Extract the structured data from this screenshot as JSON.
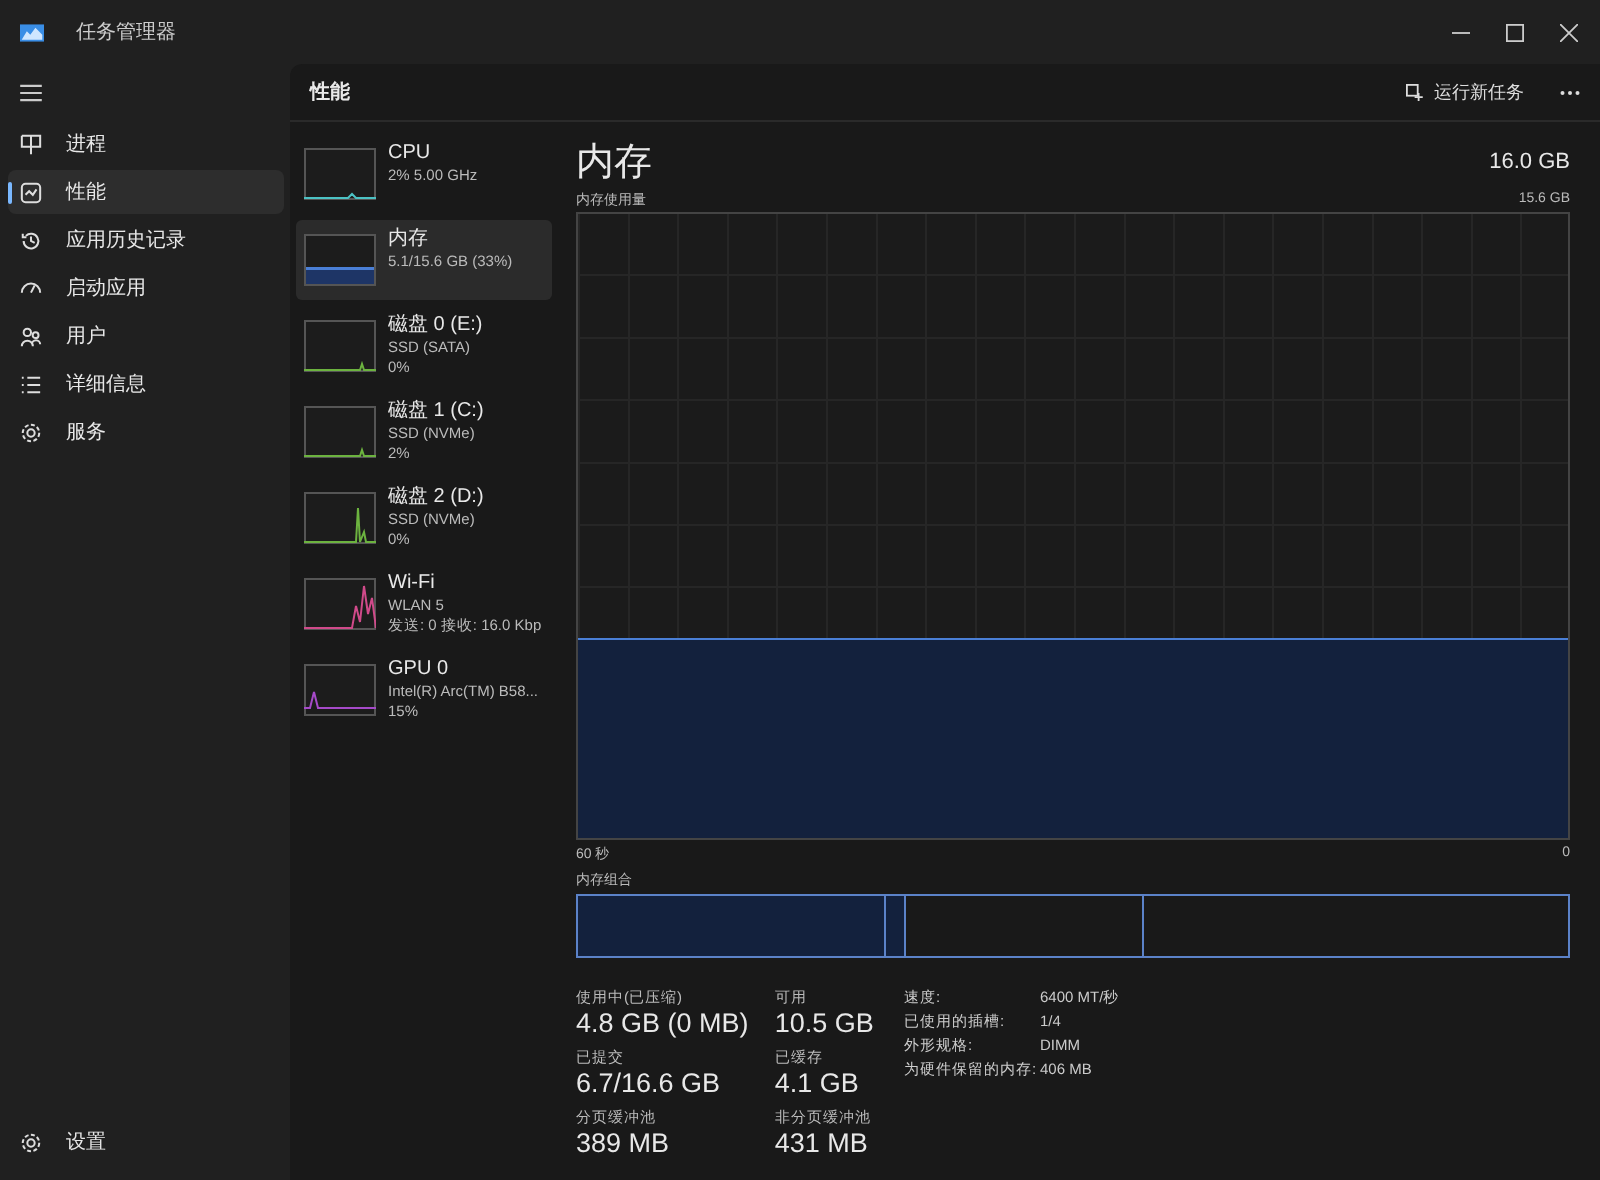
{
  "window": {
    "title": "任务管理器"
  },
  "sidebar": {
    "items": [
      {
        "label": "进程",
        "selected": false
      },
      {
        "label": "性能",
        "selected": true
      },
      {
        "label": "应用历史记录",
        "selected": false
      },
      {
        "label": "启动应用",
        "selected": false
      },
      {
        "label": "用户",
        "selected": false
      },
      {
        "label": "详细信息",
        "selected": false
      },
      {
        "label": "服务",
        "selected": false
      }
    ],
    "settings": "设置"
  },
  "header": {
    "title": "性能",
    "run_task": "运行新任务"
  },
  "devices": [
    {
      "kind": "cpu",
      "name": "CPU",
      "lines": [
        "2% 5.00 GHz"
      ],
      "color": "#4cc2c4",
      "selected": false
    },
    {
      "kind": "memory",
      "name": "内存",
      "lines": [
        "5.1/15.6 GB (33%)"
      ],
      "color": "#4a7fd6",
      "selected": true
    },
    {
      "kind": "disk",
      "name": "磁盘 0 (E:)",
      "lines": [
        "SSD (SATA)",
        "0%"
      ],
      "color": "#6cb33f",
      "selected": false
    },
    {
      "kind": "disk",
      "name": "磁盘 1 (C:)",
      "lines": [
        "SSD (NVMe)",
        "2%"
      ],
      "color": "#6cb33f",
      "selected": false
    },
    {
      "kind": "disk_spike",
      "name": "磁盘 2 (D:)",
      "lines": [
        "SSD (NVMe)",
        "0%"
      ],
      "color": "#6cb33f",
      "selected": false
    },
    {
      "kind": "network",
      "name": "Wi-Fi",
      "lines": [
        "WLAN 5",
        "发送: 0 接收: 16.0 Kbp"
      ],
      "color": "#d04a8a",
      "selected": false
    },
    {
      "kind": "gpu",
      "name": "GPU 0",
      "lines": [
        "Intel(R) Arc(TM) B58...",
        "15%"
      ],
      "color": "#a64ac9",
      "selected": false
    }
  ],
  "detail": {
    "title": "内存",
    "total": "16.0 GB",
    "usage_chart": {
      "label": "内存使用量",
      "max": "15.6 GB",
      "left_axis": "60 秒",
      "right_axis": "0"
    },
    "composition": {
      "label": "内存组合"
    },
    "stats": [
      {
        "label": "使用中(已压缩)",
        "value": "4.8 GB (0 MB)"
      },
      {
        "label": "可用",
        "value": "10.5 GB"
      },
      {
        "label": "已提交",
        "value": "6.7/16.6 GB"
      },
      {
        "label": "已缓存",
        "value": "4.1 GB"
      },
      {
        "label": "分页缓冲池",
        "value": "389 MB"
      },
      {
        "label": "非分页缓冲池",
        "value": "431 MB"
      }
    ],
    "properties": [
      {
        "key": "速度:",
        "value": "6400 MT/秒"
      },
      {
        "key": "已使用的插槽:",
        "value": "1/4"
      },
      {
        "key": "外形规格:",
        "value": "DIMM"
      },
      {
        "key": "为硬件保留的内存:",
        "value": "406 MB"
      }
    ]
  }
}
